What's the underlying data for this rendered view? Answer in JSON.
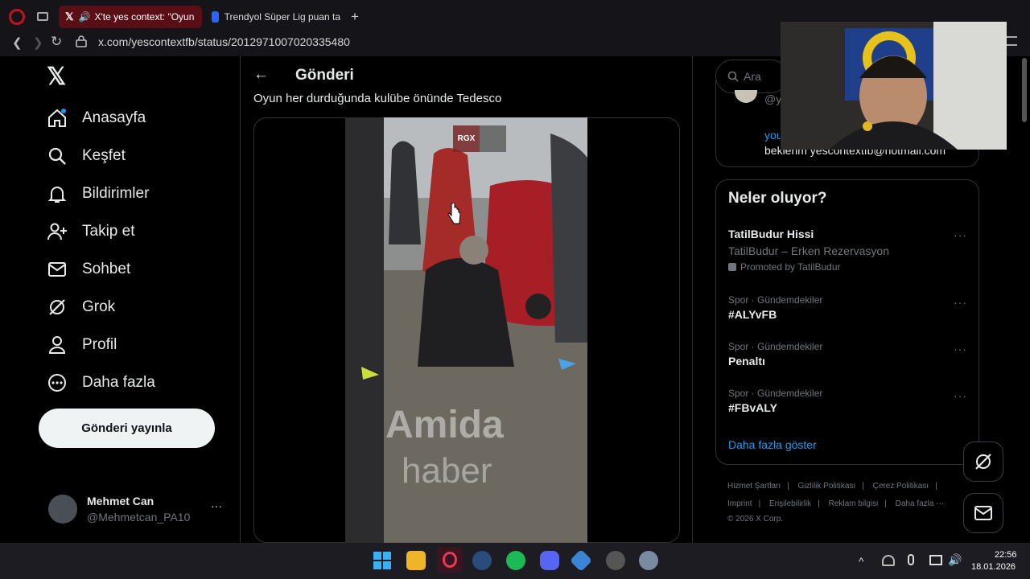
{
  "browser": {
    "tabs": [
      {
        "label": "X'te yes context: \"Oyun"
      },
      {
        "label": "Trendyol Süper Lig puan ta"
      }
    ],
    "url": "x.com/yescontextfb/status/2012971007020335480",
    "new_tab": "+"
  },
  "sidebar": {
    "logo": "𝕏",
    "items": [
      {
        "label": "Anasayfa"
      },
      {
        "label": "Keşfet"
      },
      {
        "label": "Bildirimler"
      },
      {
        "label": "Takip et"
      },
      {
        "label": "Sohbet"
      },
      {
        "label": "Grok"
      },
      {
        "label": "Profil"
      },
      {
        "label": "Daha fazla"
      }
    ],
    "post_button": "Gönderi yayınla",
    "user": {
      "name": "Mehmet Can",
      "handle": "@Mehmetcan_PA10",
      "more": "···"
    }
  },
  "main": {
    "back": "←",
    "title": "Gönderi",
    "tweet_text": "Oyun her durduğunda kulübe önünde Tedesco",
    "video": {
      "badge": "RGX",
      "watermark_1": "Amida",
      "watermark_2": "haber"
    }
  },
  "right": {
    "search_placeholder": "Ara",
    "profile_fragment": {
      "handle": "@y",
      "link": "you",
      "email_line": "beklerim yescontextfb@hotmail.com"
    },
    "trends_title": "Neler oluyor?",
    "promo": {
      "title": "TatilBudur Hissi",
      "subtitle": "TatilBudur – Erken Rezervasyon",
      "promoted": "Promoted by TatilBudur"
    },
    "trends": [
      {
        "context": "Spor · Gündemdekiler",
        "name": "#ALYvFB"
      },
      {
        "context": "Spor · Gündemdekiler",
        "name": "Penaltı"
      },
      {
        "context": "Spor · Gündemdekiler",
        "name": "#FBvALY"
      }
    ],
    "show_more": "Daha fazla göster",
    "footer_row1": [
      "Hizmet Şartları",
      "Gizlilik Politikası",
      "Çerez Politikası"
    ],
    "footer_row2": [
      "Imprint",
      "Erişilebilirlik",
      "Reklam bilgisi",
      "Daha fazla ···"
    ],
    "copyright": "© 2026 X Corp."
  },
  "taskbar": {
    "time": "22:56",
    "date": "18.01.2026",
    "chevron": "^"
  },
  "colors": {
    "accent": "#1d9bf0",
    "browser_accent": "#c1121f",
    "background": "#000000"
  }
}
